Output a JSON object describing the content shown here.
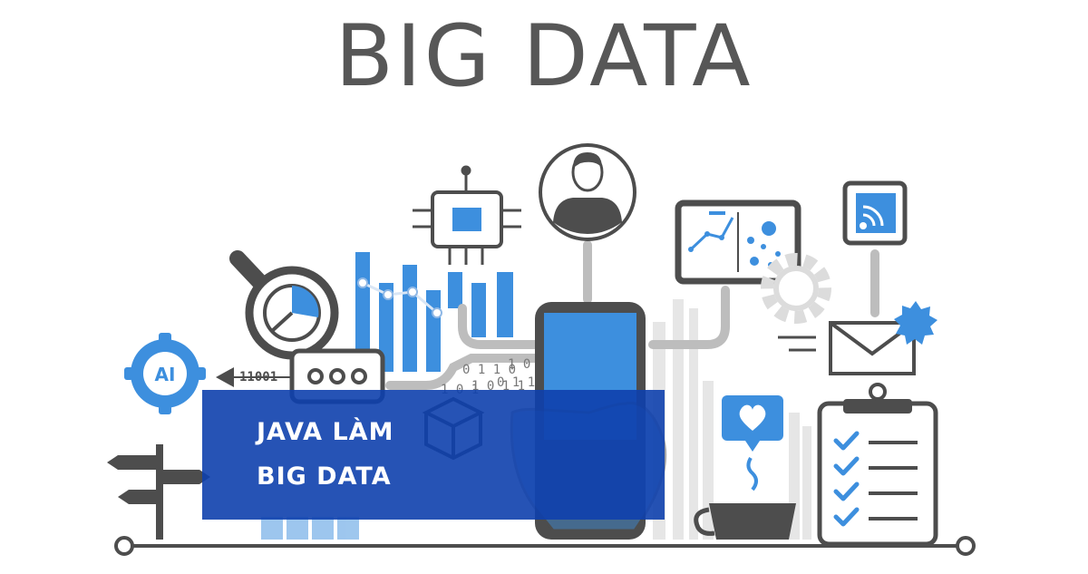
{
  "title": "BIG DATA",
  "banner": {
    "line1": "JAVA LÀM",
    "line2": "BIG DATA"
  },
  "labels": {
    "ai": "AI",
    "binary_arrow": "11001",
    "binary_stream": [
      "1 0 1",
      "0 1 1 0",
      "1 0 1 1",
      "0 1 1 0",
      "1 0 1"
    ]
  },
  "colors": {
    "accent_blue": "#3d8fde",
    "dark_gray": "#4d4d4d",
    "light_gray": "#d9d9d9",
    "banner_blue": "#0e40ad",
    "text_gray": "#575757"
  },
  "icons": [
    "ai-chip-icon",
    "magnifier-pie-icon",
    "chat-bubble-icon",
    "cpu-chip-icon",
    "user-avatar-icon",
    "smartphone-icon",
    "analytics-board-icon",
    "gear-icon",
    "wifi-signal-icon",
    "email-envelope-icon",
    "badge-icon",
    "coffee-cup-heart-icon",
    "checklist-clipboard-icon",
    "signpost-icon",
    "cube-hand-icon"
  ]
}
